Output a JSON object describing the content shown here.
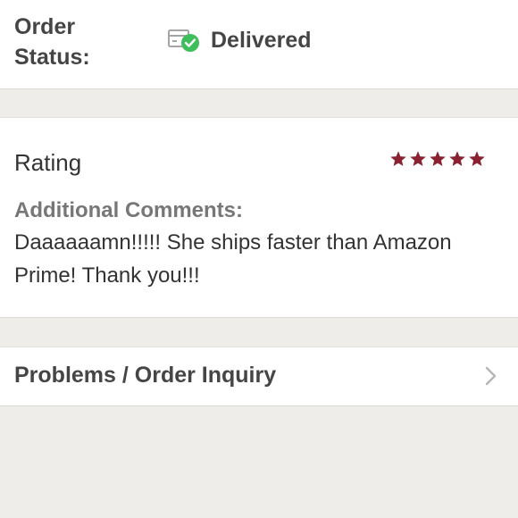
{
  "order_status": {
    "label_line1": "Order",
    "label_line2": "Status:",
    "value": "Delivered",
    "icon": "package-delivered-icon",
    "status_color": "#3fbf5c"
  },
  "rating": {
    "title": "Rating",
    "stars": 5,
    "max_stars": 5,
    "star_color": "#8b2232"
  },
  "comments": {
    "label": "Additional Comments:",
    "text": "Daaaaaamn!!!!! She ships faster than Amazon Prime! Thank you!!!"
  },
  "inquiry": {
    "label": "Problems / Order Inquiry",
    "icon": "chevron-right-icon"
  }
}
